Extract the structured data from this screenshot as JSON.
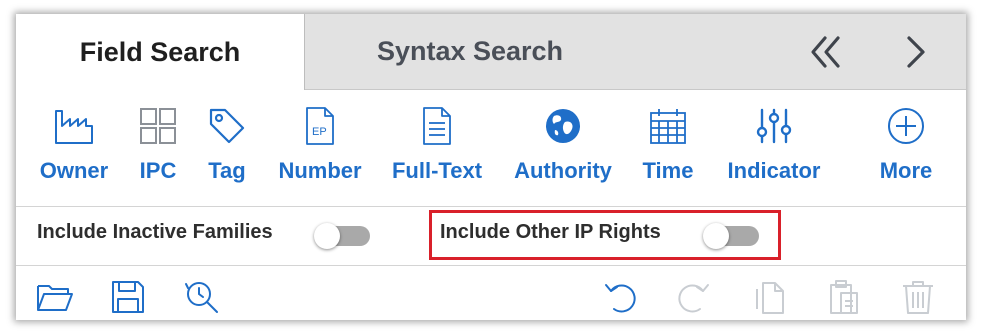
{
  "tabs": {
    "field_search": "Field Search",
    "syntax_search": "Syntax Search",
    "prev_icon": "double-chevron-left-icon",
    "next_icon": "chevron-right-icon"
  },
  "tools": [
    {
      "label": "Owner",
      "icon": "factory-icon"
    },
    {
      "label": "IPC",
      "icon": "grid-icon"
    },
    {
      "label": "Tag",
      "icon": "tag-icon"
    },
    {
      "label": "Number",
      "icon": "document-ep-icon"
    },
    {
      "label": "Full-Text",
      "icon": "document-text-icon"
    },
    {
      "label": "Authority",
      "icon": "globe-icon"
    },
    {
      "label": "Time",
      "icon": "calendar-icon"
    },
    {
      "label": "Indicator",
      "icon": "sliders-icon"
    },
    {
      "label": "More",
      "icon": "plus-circle-icon"
    }
  ],
  "tool_icon_text": {
    "ep": "EP"
  },
  "options": {
    "include_inactive_families": {
      "label": "Include Inactive Families",
      "enabled": false
    },
    "include_other_ip_rights": {
      "label": "Include Other IP Rights",
      "enabled": false
    }
  },
  "actions": {
    "open": "folder-icon",
    "save": "save-icon",
    "history": "history-search-icon",
    "undo": "undo-icon",
    "redo": "redo-icon",
    "copy": "copy-icon",
    "paste": "paste-icon",
    "delete": "trash-icon"
  },
  "colors": {
    "accent": "#1f6ec8",
    "disabled_icon": "#c9cdd2",
    "highlight": "#d9202a",
    "inactive_tab": "#e2e2e2"
  }
}
